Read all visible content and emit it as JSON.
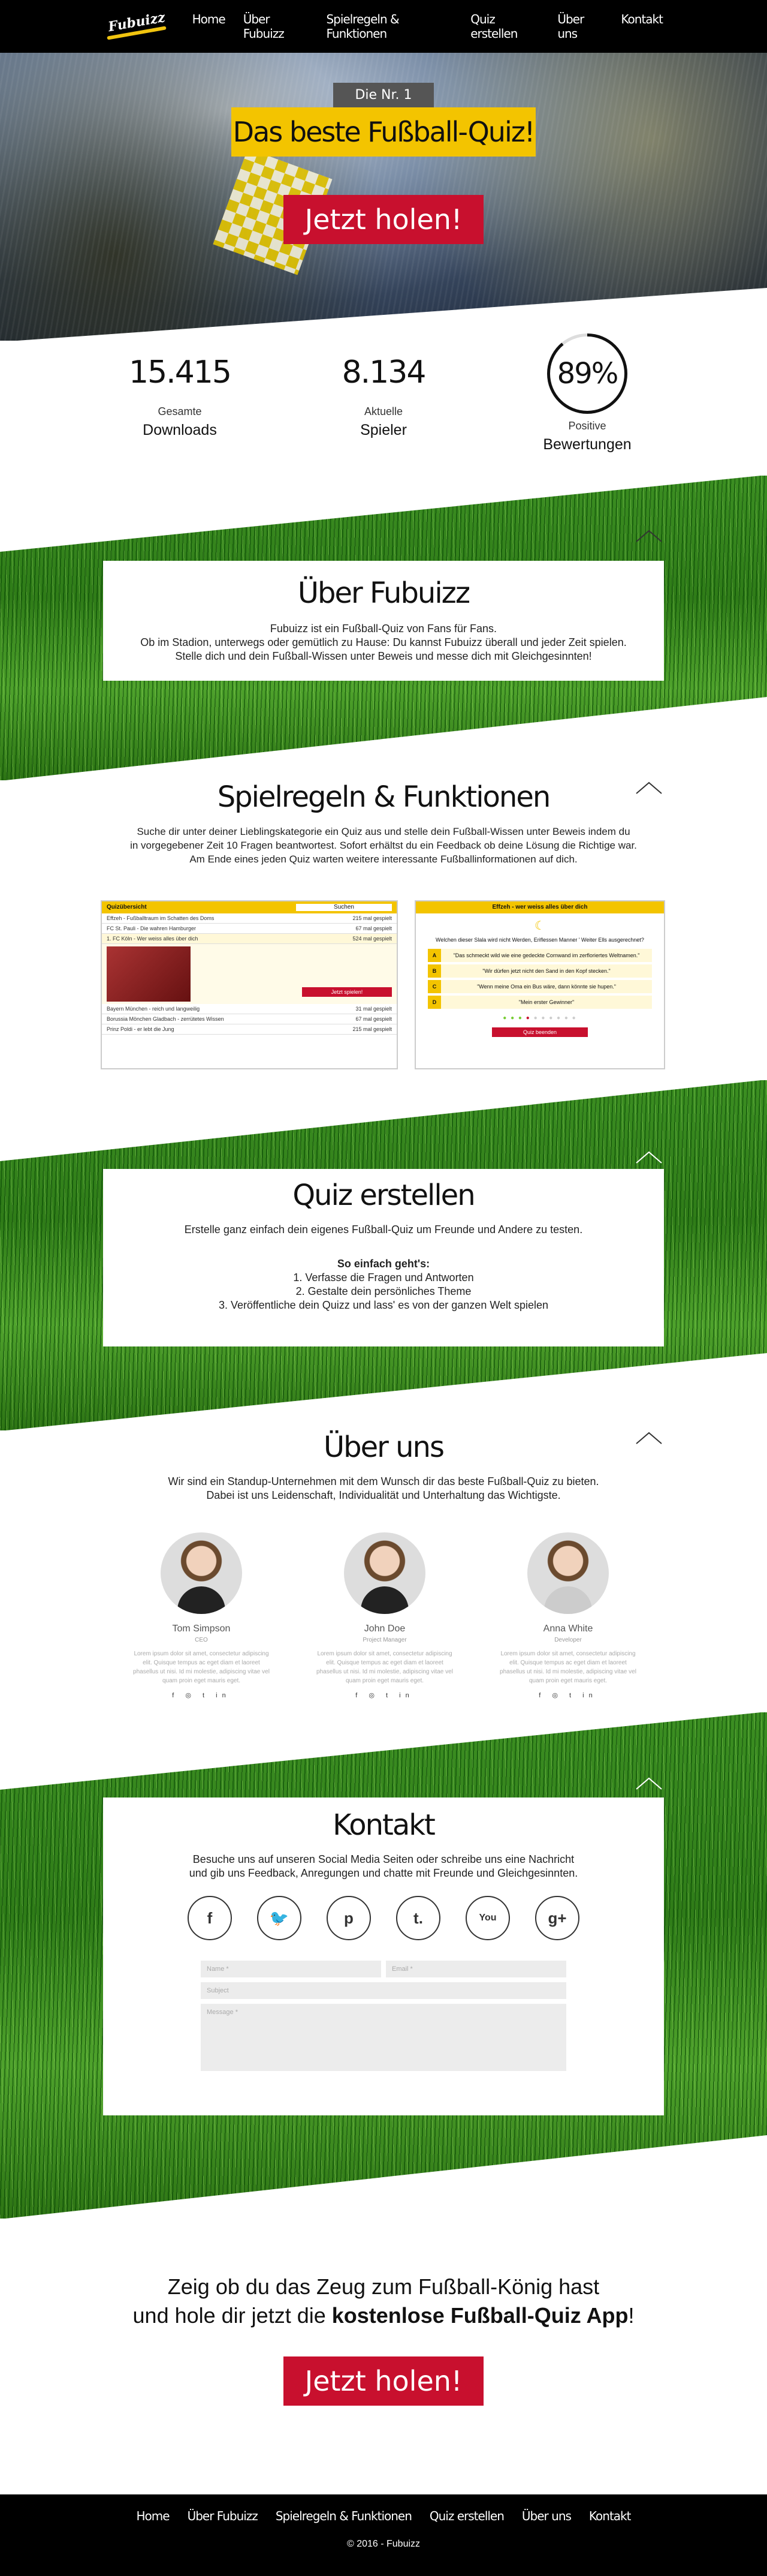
{
  "nav": {
    "logo": "Fubuizz",
    "items": [
      "Home",
      "Über Fubuizz",
      "Spielregeln & Funktionen",
      "Quiz erstellen",
      "Über uns",
      "Kontakt"
    ]
  },
  "hero": {
    "badge": "Die Nr. 1",
    "title": "Das beste Fußball-Quiz!",
    "button": "Jetzt holen!"
  },
  "stats": {
    "downloads_num": "15.415",
    "downloads_l1": "Gesamte",
    "downloads_l2": "Downloads",
    "players_num": "8.134",
    "players_l1": "Aktuelle",
    "players_l2": "Spieler",
    "rating_num": "89%",
    "rating_fraction": 0.89,
    "rating_l1": "Positive",
    "rating_l2": "Bewertungen"
  },
  "about": {
    "title": "Über Fubuizz",
    "line1": "Fubuizz ist ein Fußball-Quiz von Fans für Fans.",
    "line2": "Ob im Stadion, unterwegs oder gemütlich zu Hause: Du kannst Fubuizz überall und jeder Zeit spielen.",
    "line3": "Stelle dich und dein Fußball-Wissen unter Beweis und messe dich mit Gleichgesinnten!"
  },
  "rules": {
    "title": "Spielregeln & Funktionen",
    "line1": "Suche dir unter deiner Lieblingskategorie ein Quiz aus und stelle dein Fußball-Wissen unter Beweis indem du",
    "line2": "in vorgegebener Zeit 10 Fragen beantwortest. Sofort erhältst du ein Feedback ob deine Lösung die Richtige war.",
    "line3": "Am Ende eines jeden Quiz warten weitere interessante Fußballinformationen auf dich.",
    "shot1": {
      "header": "Quizübersicht",
      "search": "Suchen",
      "rows": [
        {
          "t": "Effzeh - Fußballtraum im Schatten des Doms",
          "n": "215 mal gespielt"
        },
        {
          "t": "FC St. Pauli - Die wahren Hamburger",
          "n": "67 mal gespielt"
        },
        {
          "t": "1. FC Köln - Wer weiss alles über dich",
          "n": "524 mal gespielt"
        },
        {
          "t": "Bayern München - reich und langweilig",
          "n": "31 mal gespielt"
        },
        {
          "t": "Borussia Mönchen Gladbach - zerrütetes Wissen",
          "n": "67 mal gespielt"
        },
        {
          "t": "Prinz Poldi - er lebt die Jung",
          "n": "215 mal gespielt"
        }
      ],
      "button": "Jetzt spielen!"
    },
    "shot2": {
      "header": "Effzeh - wer weiss alles über dich",
      "question": "Welchen dieser Slala wird nicht Werden, Eriflessen Manner ' Weiter Ells ausgerechnet?",
      "answers": [
        {
          "k": "A",
          "t": "\"Das schmeckt wild wie eine gedeckte Cornwand im zerfloriertes Weltnamen.\""
        },
        {
          "k": "B",
          "t": "\"Wir dürfen jetzt nicht den Sand in den Kopf stecken.\""
        },
        {
          "k": "C",
          "t": "\"Wenn meine Oma ein Bus wäre, dann könnte sie hupen.\""
        },
        {
          "k": "D",
          "t": "\"Mein erster Gewinner\""
        }
      ],
      "button": "Quiz beenden"
    }
  },
  "create": {
    "title": "Quiz erstellen",
    "line1": "Erstelle ganz einfach dein eigenes Fußball-Quiz um Freunde und Andere zu testen.",
    "howto": "So einfach geht's:",
    "steps": [
      "1. Verfasse die Fragen und Antworten",
      "2. Gestalte dein persönliches Theme",
      "3. Veröffentliche dein Quizz und lass' es von der ganzen Welt spielen"
    ]
  },
  "us": {
    "title": "Über uns",
    "line1": "Wir sind ein Standup-Unternehmen mit dem Wunsch dir das beste Fußball-Quiz zu bieten.",
    "line2": "Dabei ist uns Leidenschaft, Individualität und Unterhaltung das Wichtigste.",
    "team": [
      {
        "name": "Tom Simpson",
        "role": "CEO"
      },
      {
        "name": "John Doe",
        "role": "Project Manager"
      },
      {
        "name": "Anna White",
        "role": "Developer"
      }
    ],
    "lorem": "Lorem ipsum dolor sit amet, consectetur adipiscing elit. Quisque tempus ac eget diam et laoreet phasellus ut nisi. Id mi molestie, adipiscing vitae vel quam proin eget mauris eget.",
    "social": "f ◎ t in"
  },
  "contact": {
    "title": "Kontakt",
    "line1": "Besuche uns auf unseren Social Media Seiten oder schreibe uns eine Nachricht",
    "line2": "und gib uns Feedback, Anregungen und chatte mit Freunde und Gleichgesinnten.",
    "icons": [
      {
        "icon": "facebook-icon",
        "glyph": "f"
      },
      {
        "icon": "twitter-icon",
        "glyph": "🐦"
      },
      {
        "icon": "pinterest-icon",
        "glyph": "p"
      },
      {
        "icon": "tumblr-icon",
        "glyph": "t."
      },
      {
        "icon": "youtube-icon",
        "glyph": "You"
      },
      {
        "icon": "googleplus-icon",
        "glyph": "g+"
      }
    ],
    "name_ph": "Name *",
    "email_ph": "Email *",
    "subject_ph": "Subject",
    "message_ph": "Message *"
  },
  "cta": {
    "line1": "Zeig ob du das Zeug zum Fußball-König hast",
    "line2_a": "und hole dir jetzt die ",
    "line2_b": "kostenlose Fußball-Quiz App",
    "line2_c": "!",
    "button": "Jetzt holen!"
  },
  "footer": {
    "copy": "© 2016 - Fubuizz"
  },
  "colors": {
    "accent": "#f3c400",
    "cta": "#c8102e",
    "grass": "#3c8f22"
  }
}
